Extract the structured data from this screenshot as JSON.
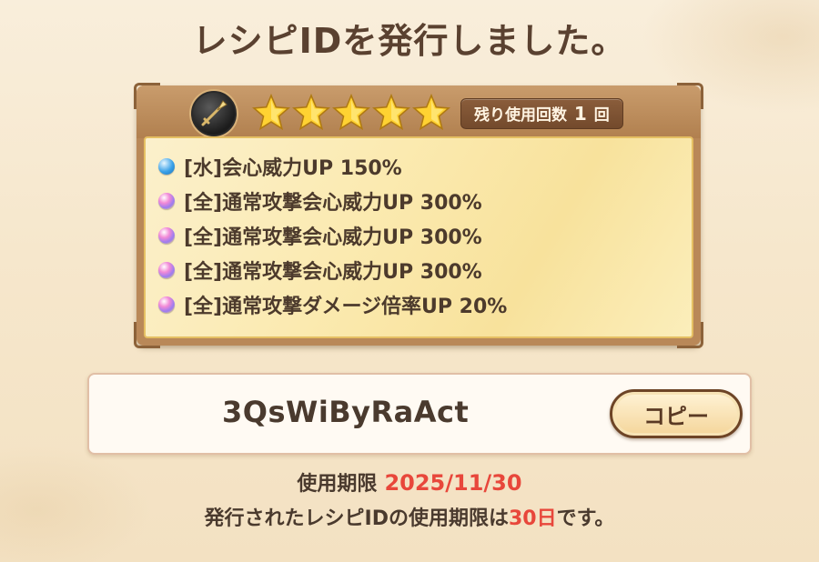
{
  "title": "レシピIDを発行しました。",
  "recipe": {
    "weapon_icon": "spear-icon",
    "rarity_stars": 5,
    "uses": {
      "label": "残り使用回数",
      "count": "1",
      "unit": "回"
    },
    "effects": [
      {
        "orb": "water-orb-icon",
        "text": "[水]会心威力UP 150%"
      },
      {
        "orb": "all-orb-icon",
        "text": "[全]通常攻撃会心威力UP 300%"
      },
      {
        "orb": "all-orb-icon",
        "text": "[全]通常攻撃会心威力UP 300%"
      },
      {
        "orb": "all-orb-icon",
        "text": "[全]通常攻撃会心威力UP 300%"
      },
      {
        "orb": "all-orb-icon",
        "text": "[全]通常攻撃ダメージ倍率UP 20%"
      }
    ]
  },
  "recipe_id": {
    "value": "3QsWiByRaAct",
    "copy_label": "コピー"
  },
  "expiry": {
    "label": "使用期限",
    "date": "2025/11/30"
  },
  "note": {
    "prefix": "発行されたレシピIDの使用期限は",
    "days": "30日",
    "suffix": "です。"
  },
  "colors": {
    "accent_red": "#e8473b",
    "text_brown": "#4a3a2e",
    "card_frame": "#b98858"
  }
}
